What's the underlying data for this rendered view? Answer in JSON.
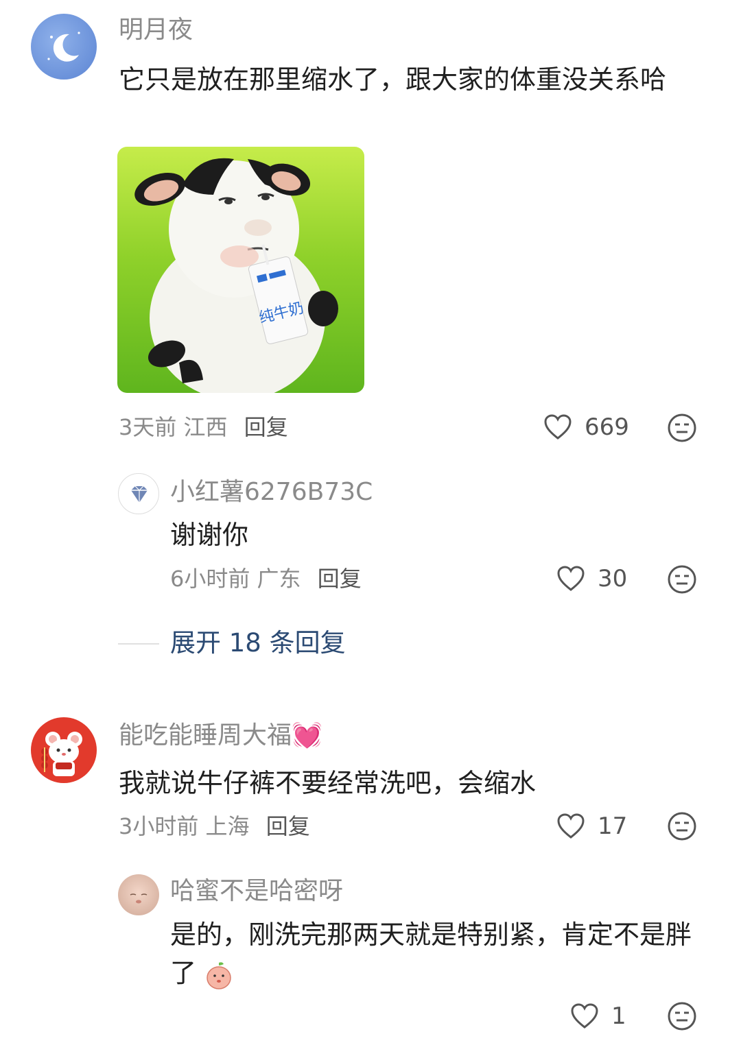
{
  "comments": [
    {
      "username": "明月夜",
      "text": "它只是放在那里缩水了，跟大家的体重没关系哈",
      "image_text": "纯牛奶",
      "time": "3天前",
      "location": "江西",
      "reply_label": "回复",
      "likes": "669",
      "replies": [
        {
          "username": "小红薯6276B73C",
          "text": "谢谢你",
          "time": "6小时前",
          "location": "广东",
          "reply_label": "回复",
          "likes": "30"
        }
      ],
      "expand_label": "展开 18 条回复"
    },
    {
      "username": "能吃能睡周大福💓",
      "text": "我就说牛仔裤不要经常洗吧，会缩水",
      "time": "3小时前",
      "location": "上海",
      "reply_label": "回复",
      "likes": "17",
      "replies": [
        {
          "username": "哈蜜不是哈密呀",
          "text": "是的，刚洗完那两天就是特别紧，肯定不是胖了",
          "time": "",
          "location": "",
          "reply_label": "",
          "likes": "1"
        }
      ]
    }
  ],
  "icons": {
    "like": "heart-outline-icon",
    "emoji": "neutral-face-icon",
    "verified": "diamond-icon"
  },
  "colors": {
    "expand_link": "#2b4a73",
    "secondary_text": "#8a8a8a"
  }
}
